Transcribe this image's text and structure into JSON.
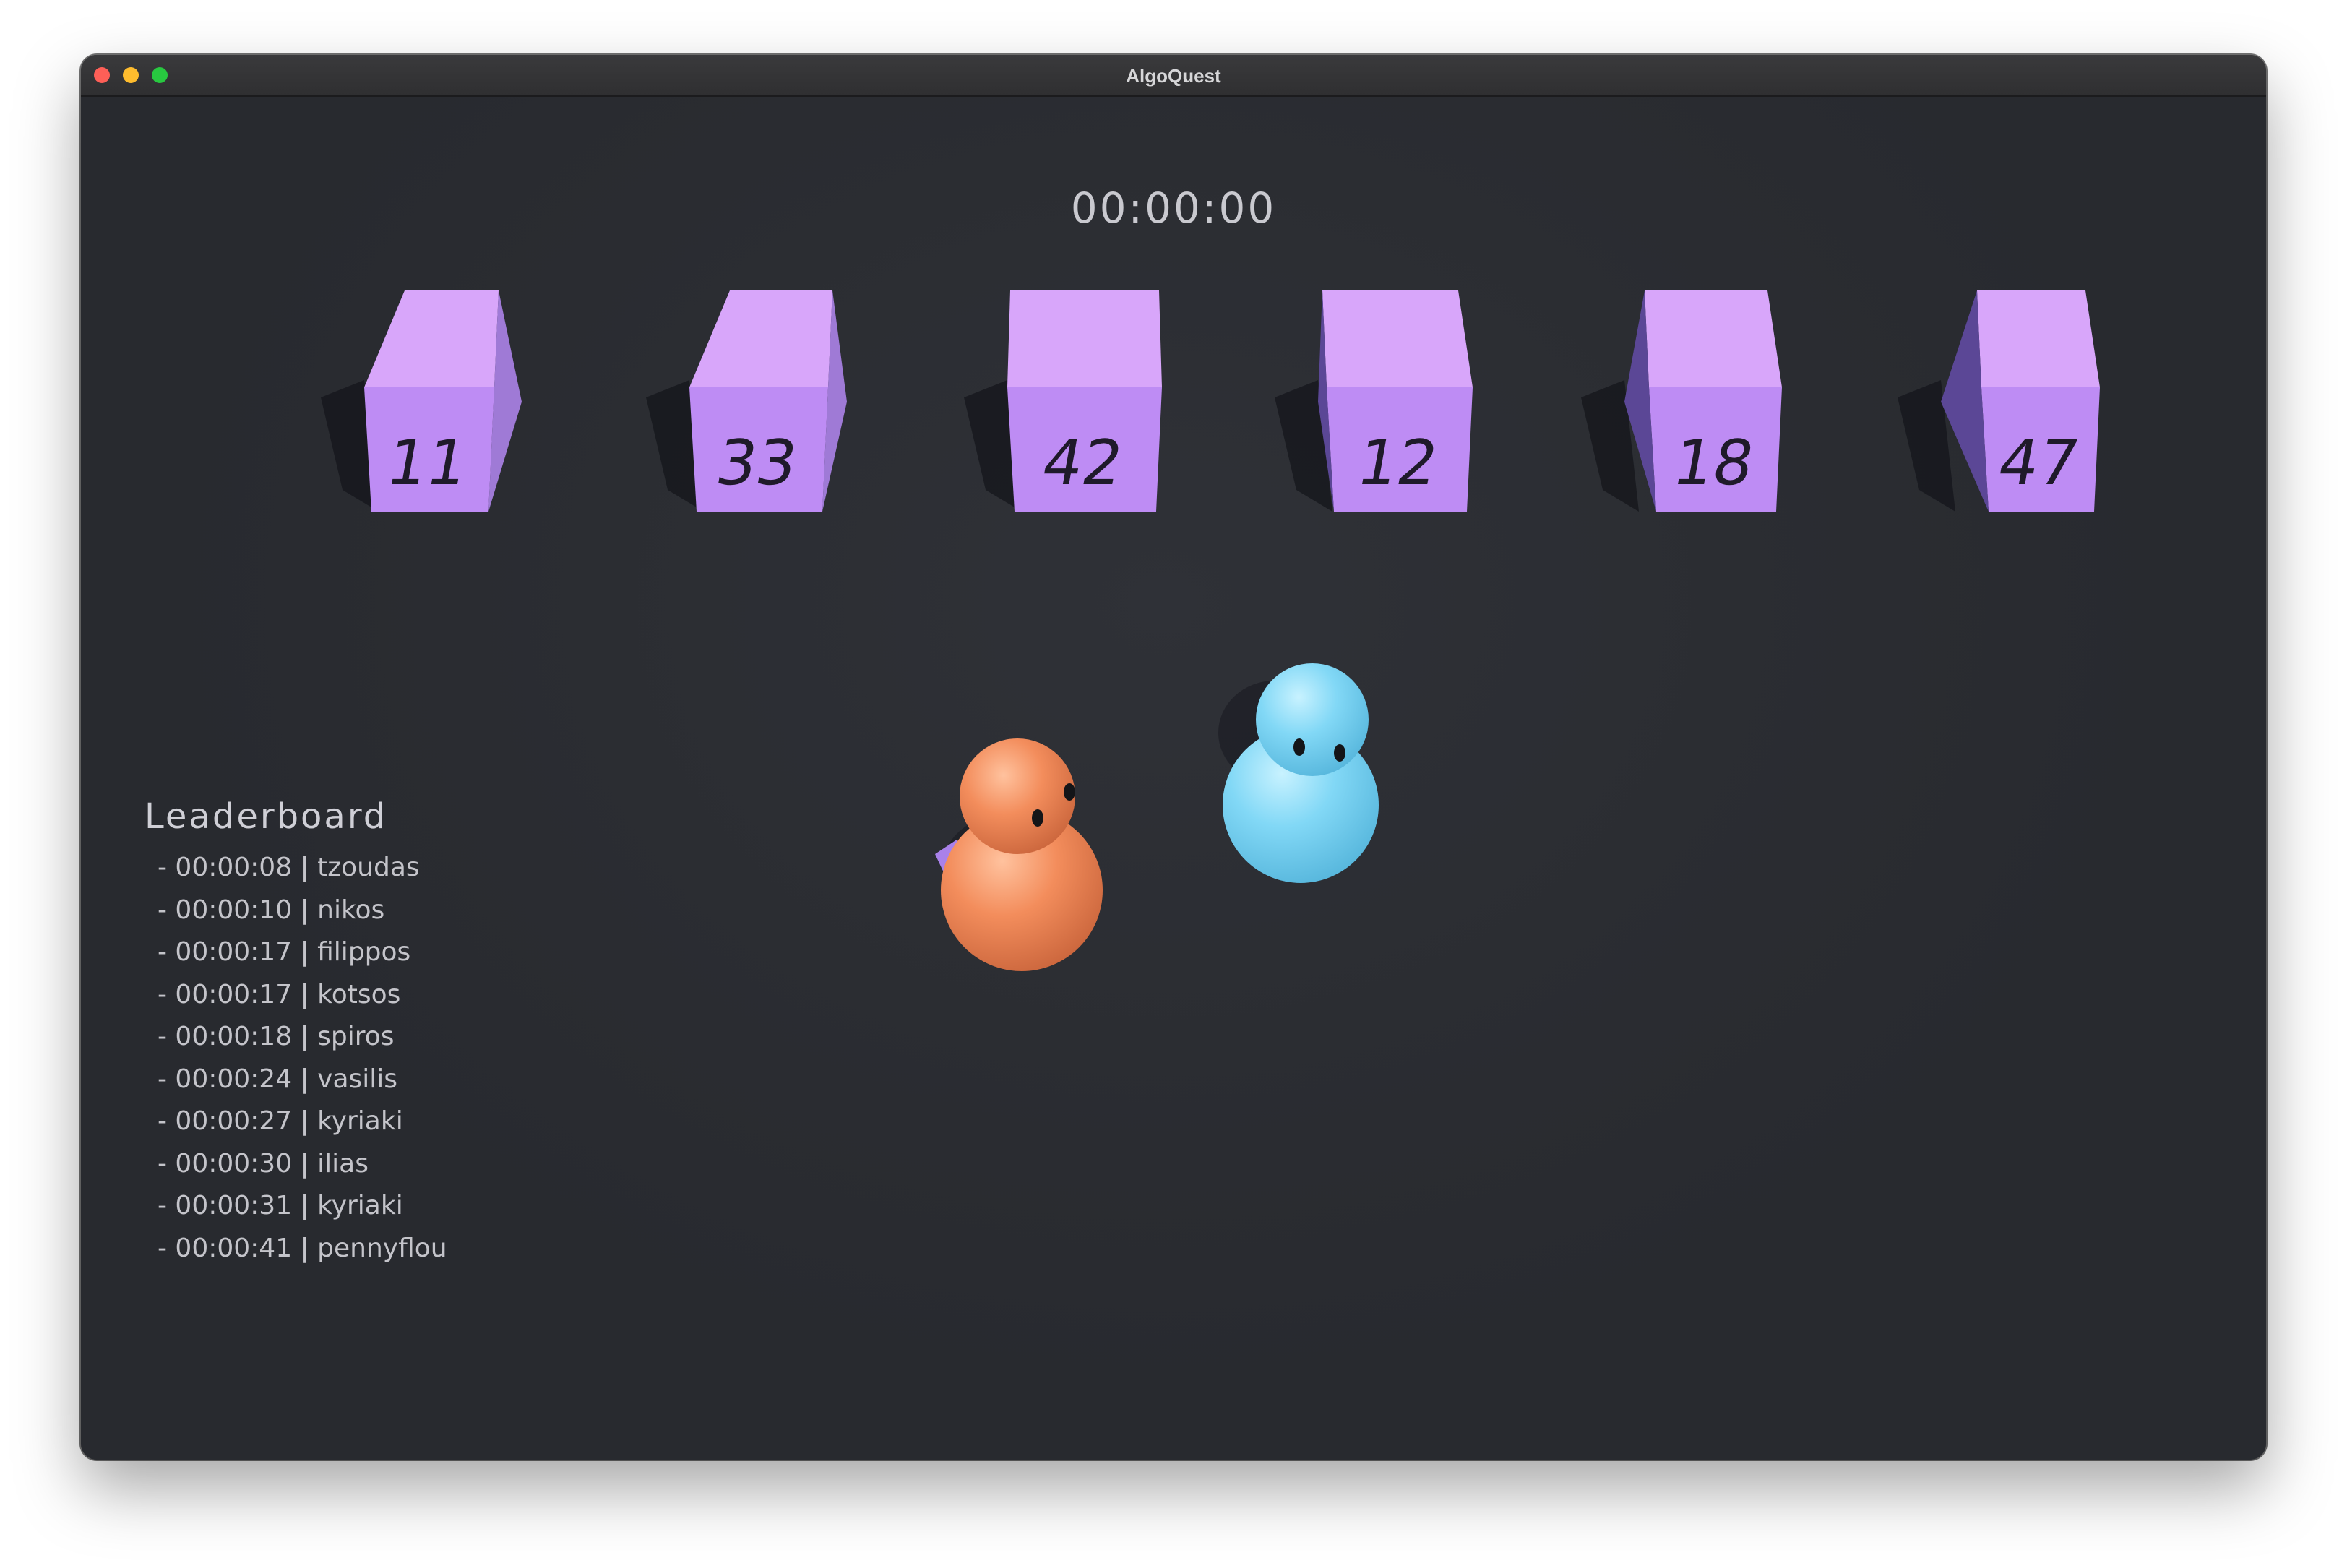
{
  "window": {
    "title": "AlgoQuest"
  },
  "hud": {
    "timer": "00:00:00"
  },
  "cubes": [
    {
      "value": "11"
    },
    {
      "value": "33"
    },
    {
      "value": "42"
    },
    {
      "value": "12"
    },
    {
      "value": "18"
    },
    {
      "value": "47"
    }
  ],
  "characters": [
    {
      "name": "orange-player",
      "color": "#f2895a"
    },
    {
      "name": "blue-player",
      "color": "#7fd6f5"
    }
  ],
  "leaderboard": {
    "title": "Leaderboard",
    "entries": [
      {
        "text": "- 00:00:08 | tzoudas"
      },
      {
        "text": "- 00:00:10 | nikos"
      },
      {
        "text": "- 00:00:17 | filippos"
      },
      {
        "text": "- 00:00:17 | kotsos"
      },
      {
        "text": "- 00:00:18 | spiros"
      },
      {
        "text": "- 00:00:24 | vasilis"
      },
      {
        "text": "- 00:00:27 | kyriaki"
      },
      {
        "text": "- 00:00:30 | ilias"
      },
      {
        "text": "- 00:00:31 | kyriaki"
      },
      {
        "text": "- 00:00:41 | pennyflou"
      }
    ]
  },
  "colors": {
    "cube_top": "#d8a6fa",
    "cube_front": "#be8cf4",
    "cube_side_light": "#9f7ad6",
    "cube_side_dark": "#5b4796",
    "background": "#2b2d33"
  }
}
